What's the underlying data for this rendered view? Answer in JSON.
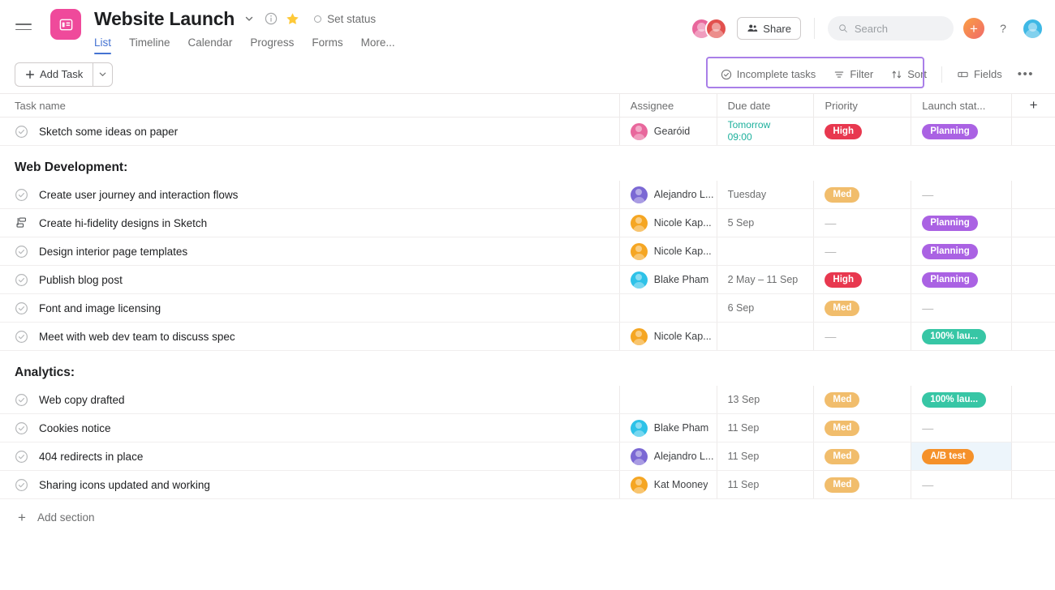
{
  "header": {
    "menu_icon": "hamburger-icon",
    "project_icon": "list-board-icon",
    "title": "Website Launch",
    "title_caret_icon": "chevron-down-icon",
    "info_icon": "info-circle-icon",
    "star_icon": "star-icon",
    "set_status_label": "Set status",
    "tabs": [
      {
        "label": "List",
        "active": true
      },
      {
        "label": "Timeline",
        "active": false
      },
      {
        "label": "Calendar",
        "active": false
      },
      {
        "label": "Progress",
        "active": false
      },
      {
        "label": "Forms",
        "active": false
      },
      {
        "label": "More...",
        "active": false
      }
    ],
    "members": [
      {
        "name": "Gearóid",
        "color": "#e8679c"
      },
      {
        "name": "Member 2",
        "color": "#e2504e"
      }
    ],
    "share_label": "Share",
    "share_icon": "people-icon",
    "search_placeholder": "Search",
    "search_value": "",
    "search_icon": "search-icon",
    "add_button_label": "+",
    "help_button_label": "?",
    "me_avatar_color": "#3eb8e5"
  },
  "toolbar": {
    "add_task_label": "Add Task",
    "add_task_plus_icon": "plus-icon",
    "add_task_caret_icon": "chevron-down-icon",
    "items": [
      {
        "label": "Incomplete tasks",
        "icon": "check-circle-icon",
        "name": "incomplete-tasks-filter"
      },
      {
        "label": "Filter",
        "icon": "filter-icon",
        "name": "filter-button"
      },
      {
        "label": "Sort",
        "icon": "sort-arrows-icon",
        "name": "sort-button"
      },
      {
        "label": "Fields",
        "icon": "fields-icon",
        "name": "fields-button"
      }
    ],
    "more_label": "•••",
    "highlight_color": "#a97fe8"
  },
  "table": {
    "columns": [
      {
        "key": "task",
        "label": "Task name"
      },
      {
        "key": "assignee",
        "label": "Assignee"
      },
      {
        "key": "due",
        "label": "Due date"
      },
      {
        "key": "priority",
        "label": "Priority"
      },
      {
        "key": "status",
        "label": "Launch stat..."
      },
      {
        "key": "add",
        "label": "+"
      }
    ],
    "rows": [
      {
        "kind": "task",
        "icon": "check-circle-icon",
        "name": "Sketch some ideas on paper",
        "assignee": "Gearóid",
        "assignee_color": "#e8679c",
        "due": "Tomorrow\n09:00",
        "due_soon": true,
        "priority": "High",
        "priority_color": "#e8384f",
        "status": "Planning",
        "status_color": "#aa62e3",
        "selected": false
      },
      {
        "kind": "section",
        "name": "Web Development:"
      },
      {
        "kind": "task",
        "icon": "check-circle-icon",
        "name": "Create user journey and interaction flows",
        "assignee": "Alejandro L...",
        "assignee_color": "#7b68d4",
        "due": "Tuesday",
        "due_soon": false,
        "priority": "Med",
        "priority_color": "#f1bd6c",
        "status": "",
        "status_color": "",
        "selected": false
      },
      {
        "kind": "task",
        "icon": "subtask-icon",
        "name": "Create hi-fidelity designs in Sketch",
        "assignee": "Nicole Kap...",
        "assignee_color": "#f5a623",
        "due": "5 Sep",
        "due_soon": false,
        "priority": "",
        "priority_color": "",
        "status": "Planning",
        "status_color": "#aa62e3",
        "selected": false
      },
      {
        "kind": "task",
        "icon": "check-circle-icon",
        "name": "Design interior page templates",
        "assignee": "Nicole Kap...",
        "assignee_color": "#f5a623",
        "due": "",
        "due_soon": false,
        "priority": "",
        "priority_color": "",
        "status": "Planning",
        "status_color": "#aa62e3",
        "selected": false
      },
      {
        "kind": "task",
        "icon": "check-circle-icon",
        "name": "Publish blog post",
        "assignee": "Blake Pham",
        "assignee_color": "#2ec2e8",
        "due": "2 May – 11 Sep",
        "due_soon": false,
        "priority": "High",
        "priority_color": "#e8384f",
        "status": "Planning",
        "status_color": "#aa62e3",
        "selected": false
      },
      {
        "kind": "task",
        "icon": "check-circle-icon",
        "name": "Font and image licensing",
        "assignee": "",
        "assignee_color": "",
        "due": "6 Sep",
        "due_soon": false,
        "priority": "Med",
        "priority_color": "#f1bd6c",
        "status": "",
        "status_color": "",
        "selected": false
      },
      {
        "kind": "task",
        "icon": "check-circle-icon",
        "name": "Meet with web dev team to discuss spec",
        "assignee": "Nicole Kap...",
        "assignee_color": "#f5a623",
        "due": "",
        "due_soon": false,
        "priority": "",
        "priority_color": "",
        "status": "100% lau...",
        "status_color": "#37c6a5",
        "selected": false
      },
      {
        "kind": "section",
        "name": "Analytics:"
      },
      {
        "kind": "task",
        "icon": "check-circle-icon",
        "name": "Web copy drafted",
        "assignee": "",
        "assignee_color": "",
        "due": "13 Sep",
        "due_soon": false,
        "priority": "Med",
        "priority_color": "#f1bd6c",
        "status": "100% lau...",
        "status_color": "#37c6a5",
        "selected": false
      },
      {
        "kind": "task",
        "icon": "check-circle-icon",
        "name": "Cookies notice",
        "assignee": "Blake Pham",
        "assignee_color": "#2ec2e8",
        "due": "11 Sep",
        "due_soon": false,
        "priority": "Med",
        "priority_color": "#f1bd6c",
        "status": "",
        "status_color": "",
        "selected": false
      },
      {
        "kind": "task",
        "icon": "check-circle-icon",
        "name": "404 redirects in place",
        "assignee": "Alejandro L...",
        "assignee_color": "#7b68d4",
        "due": "11 Sep",
        "due_soon": false,
        "priority": "Med",
        "priority_color": "#f1bd6c",
        "status": "A/B test",
        "status_color": "#f5912a",
        "selected": true
      },
      {
        "kind": "task",
        "icon": "check-circle-icon",
        "name": "Sharing icons updated and working",
        "assignee": "Kat Mooney",
        "assignee_color": "#f5a623",
        "due": "11 Sep",
        "due_soon": false,
        "priority": "Med",
        "priority_color": "#f1bd6c",
        "status": "",
        "status_color": "",
        "selected": false
      }
    ],
    "empty_dash": "—"
  },
  "footer": {
    "add_section_label": "Add section",
    "add_section_icon": "plus-icon"
  }
}
